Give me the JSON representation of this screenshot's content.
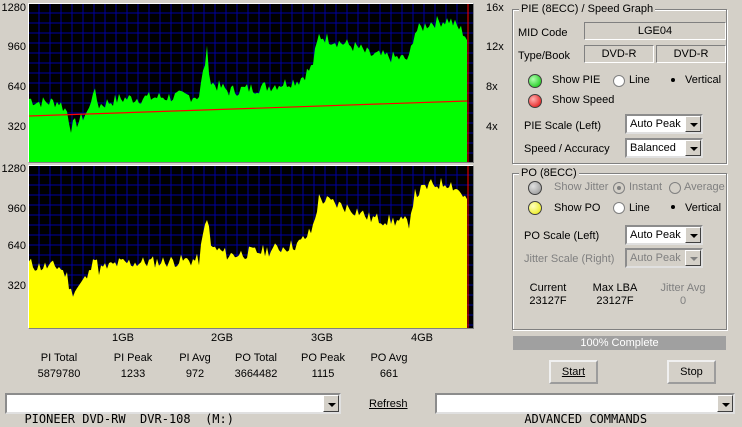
{
  "graphs": {
    "pie_ticks": [
      "1280",
      "960",
      "640",
      "320"
    ],
    "po_ticks": [
      "1280",
      "960",
      "640",
      "320"
    ],
    "speed_ticks": [
      "16x",
      "12x",
      "8x",
      "4x"
    ],
    "x_ticks": [
      "1GB",
      "2GB",
      "3GB",
      "4GB"
    ],
    "colors": {
      "pie": "#00ff00",
      "po": "#ffff00",
      "speed": "#ff0000",
      "background": "#000000",
      "grid": "#0000a0"
    }
  },
  "stats": [
    {
      "label": "PI Total",
      "value": "5879780"
    },
    {
      "label": "PI Peak",
      "value": "1233"
    },
    {
      "label": "PI Avg",
      "value": "972"
    },
    {
      "label": "PO Total",
      "value": "3664482"
    },
    {
      "label": "PO Peak",
      "value": "1115"
    },
    {
      "label": "PO Avg",
      "value": "661"
    }
  ],
  "pie_panel": {
    "title": "PIE (8ECC) / Speed Graph",
    "mid_code_label": "MID Code",
    "mid_code_value": "LGE04",
    "type_book_label": "Type/Book",
    "type_value": "DVD-R",
    "book_value": "DVD-R",
    "show_pie": "Show PIE",
    "show_speed": "Show Speed",
    "line_label": "Line",
    "vertical_label": "Vertical",
    "pie_scale_label": "PIE Scale (Left)",
    "pie_scale_value": "Auto Peak",
    "speed_accuracy_label": "Speed / Accuracy",
    "speed_accuracy_value": "Balanced"
  },
  "po_panel": {
    "title": "PO (8ECC)",
    "show_jitter": "Show Jitter",
    "instant_label": "Instant",
    "average_label": "Average",
    "show_po": "Show PO",
    "line_label": "Line",
    "vertical_label": "Vertical",
    "po_scale_label": "PO Scale (Left)",
    "po_scale_value": "Auto Peak",
    "jitter_scale_label": "Jitter Scale (Right)",
    "jitter_scale_value": "Auto Peak",
    "current_label": "Current",
    "current_value": "23127F",
    "max_lba_label": "Max LBA",
    "max_lba_value": "23127F",
    "jitter_avg_label": "Jitter Avg",
    "jitter_avg_value": "0"
  },
  "progress": {
    "label": "100% Complete",
    "percent": 100
  },
  "buttons": {
    "start": "Start",
    "stop": "Stop",
    "refresh": "Refresh"
  },
  "drive_select": "PIONEER DVD-RW  DVR-108  (M:)",
  "commands_select": "ADVANCED COMMANDS"
}
